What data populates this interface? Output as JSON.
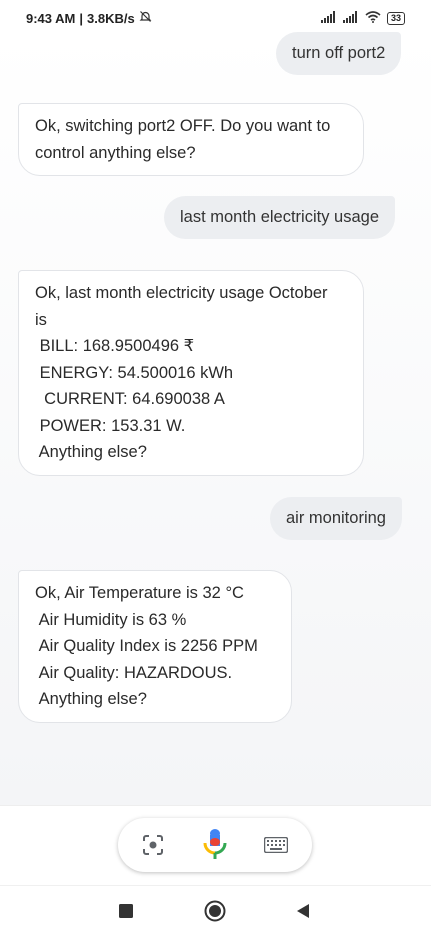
{
  "status": {
    "time": "9:43 AM",
    "speed": "3.8KB/s",
    "battery": "33"
  },
  "messages": {
    "user1": "turn off port2",
    "bot1": [
      "Ok, switching port2 OFF. Do you want to",
      "control anything else?"
    ],
    "user2": "last month electricity usage",
    "bot2": [
      "Ok, last month electricity usage October",
      "is",
      " BILL: 168.9500496 ₹",
      " ENERGY: 54.500016 kWh",
      "  CURRENT: 64.690038 A",
      " POWER: 153.31 W.",
      " Anything else?"
    ],
    "user3": "air monitoring",
    "bot3": [
      "Ok, Air Temperature is 32 °C",
      " Air Humidity is 63 %",
      " Air Quality Index is 2256 PPM",
      " Air Quality: HAZARDOUS.",
      " Anything else?"
    ]
  },
  "colors": {
    "mic_blue": "#4285F4",
    "mic_red": "#EA4335",
    "mic_yellow": "#FBBC05",
    "mic_green": "#34A853"
  },
  "icons": {
    "lens": "lens-icon",
    "mic": "mic-icon",
    "keyboard": "keyboard-icon",
    "recents": "recents-square-icon",
    "home": "home-circle-icon",
    "back": "back-triangle-icon"
  }
}
